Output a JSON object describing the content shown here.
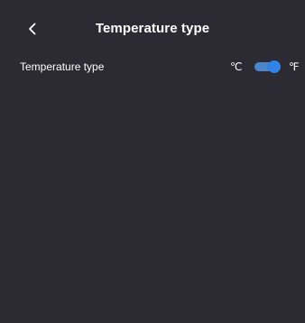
{
  "header": {
    "title": "Temperature type",
    "back_icon": "chevron-left-icon"
  },
  "setting": {
    "label": "Temperature type",
    "left_unit": "℃",
    "right_unit": "℉",
    "toggle_state": "on",
    "accent_color": "#2f83e9",
    "track_color": "#4b86c9"
  },
  "colors": {
    "background": "#2c2b33",
    "text": "#ffffff"
  }
}
